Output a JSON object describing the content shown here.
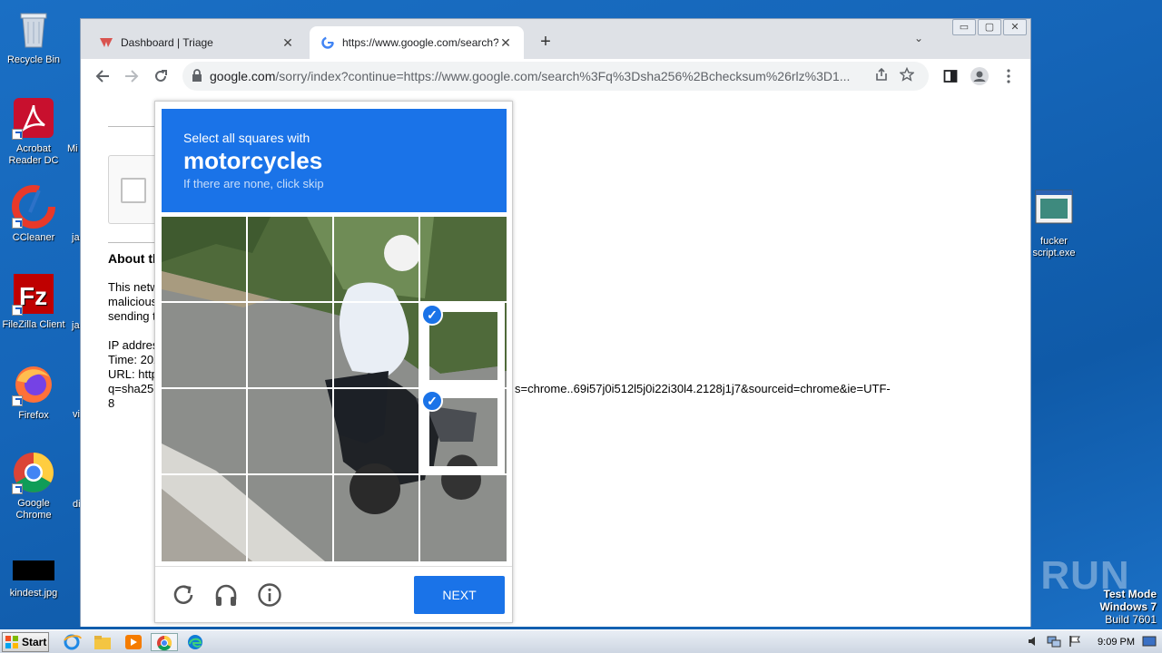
{
  "desktop": {
    "icons": [
      {
        "label": "Recycle Bin"
      },
      {
        "label": "Acrobat Reader DC"
      },
      {
        "label": "CCleaner"
      },
      {
        "label": "FileZilla Client"
      },
      {
        "label": "Firefox"
      },
      {
        "label": "Google Chrome"
      },
      {
        "label": "kindest.jpg"
      },
      {
        "label": "fucker script.exe"
      }
    ],
    "clipped_labels": [
      "Mi",
      "ja",
      "ja",
      "vi",
      "di"
    ],
    "watermark": {
      "line1": "Test Mode",
      "line2": "Windows 7",
      "line3": "Build 7601"
    },
    "anyrun_text": "ANY RUN"
  },
  "browser": {
    "tabs": [
      {
        "title": "Dashboard | Triage",
        "close": "✕"
      },
      {
        "title": "https://www.google.com/search?q=",
        "close": "✕"
      }
    ],
    "new_tab": "+",
    "tab_menu": "⌄",
    "window_buttons": [
      "▭",
      "▢",
      "✕"
    ],
    "url_host": "google.com",
    "url_path": "/sorry/index?continue=https://www.google.com/search%3Fq%3Dsha256%2Bchecksum%26rlz%3D1..."
  },
  "page": {
    "about": "About th",
    "p1": [
      "This netw",
      "malicious",
      "sending t"
    ],
    "p2": [
      "IP addres",
      "Time: 202",
      "URL: http",
      "q=sha256"
    ],
    "url_tail": "s=chrome..69i57j0i512l5j0i22i30l4.2128j1j7&sourceid=chrome&ie=UTF-",
    "url_tail2": "8"
  },
  "captcha": {
    "instruction": "Select all squares with",
    "target": "motorcycles",
    "hint": "If there are none, click skip",
    "next_label": "NEXT",
    "selected_cells": [
      7,
      11
    ]
  },
  "taskbar": {
    "start_label": "Start",
    "clock": "9:09 PM"
  },
  "colors": {
    "accent": "#1a73e8",
    "desktop": "#1565b8"
  }
}
